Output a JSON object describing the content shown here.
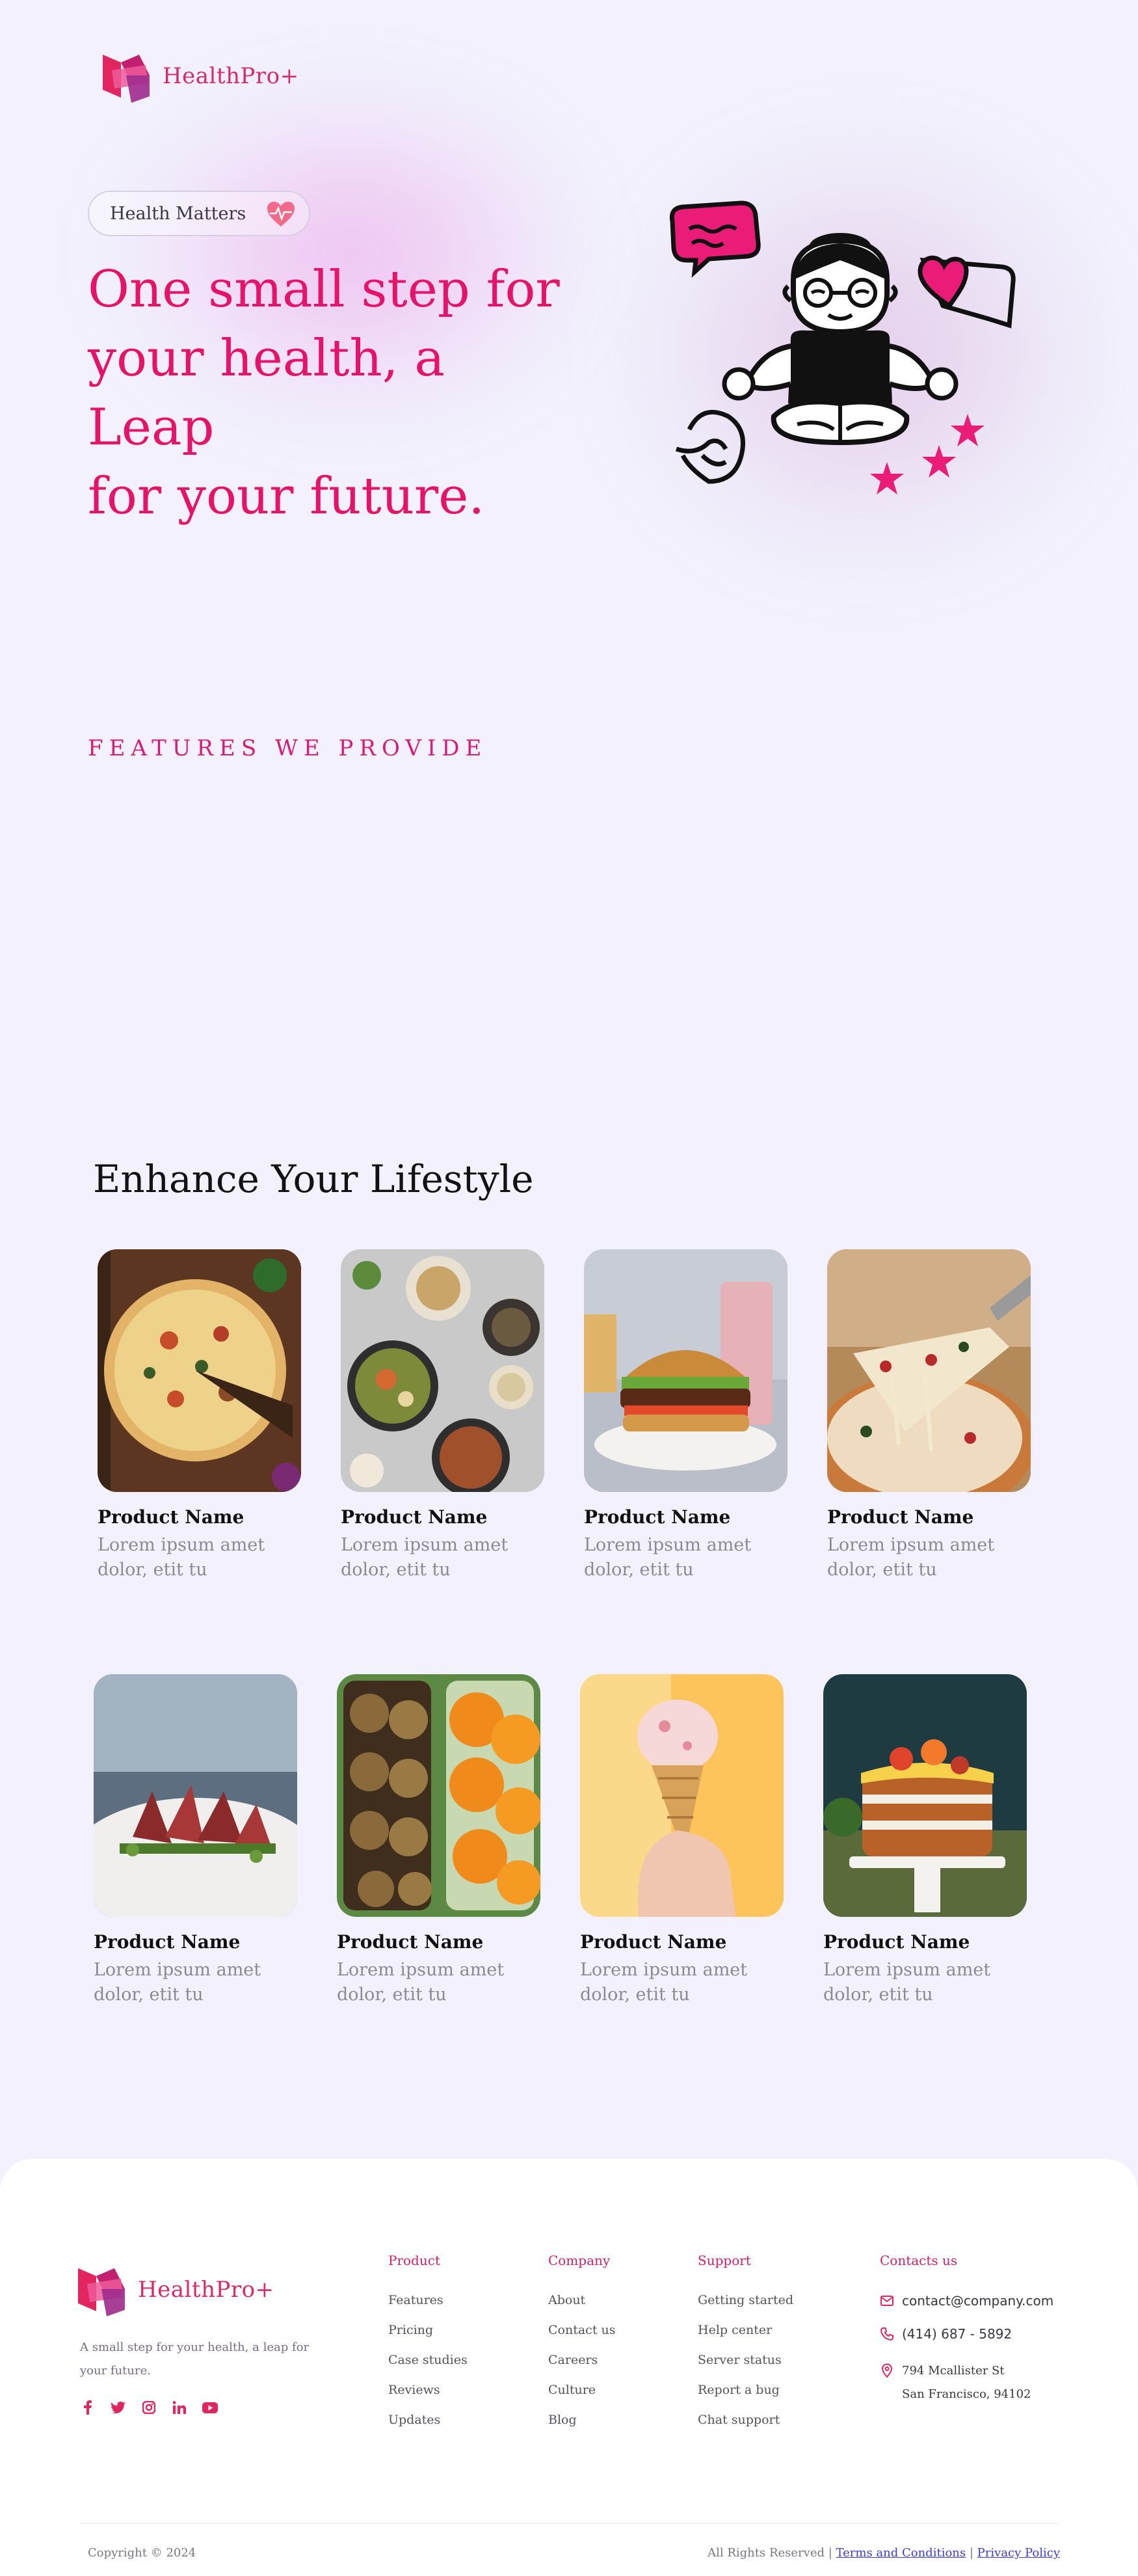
{
  "brand": {
    "name": "HealthPro+"
  },
  "hero": {
    "badge_label": "Health Matters",
    "title_lines": [
      "One small step for",
      "your health, a Leap",
      "for your future."
    ]
  },
  "features": {
    "label": "FEATURES WE PROVIDE"
  },
  "products": {
    "title": "Enhance Your Lifestyle",
    "items": [
      {
        "name": "Product Name",
        "desc": "Lorem ipsum amet dolor, etit tu",
        "image": "pizza"
      },
      {
        "name": "Product Name",
        "desc": "Lorem ipsum amet dolor, etit tu",
        "image": "thai-dishes"
      },
      {
        "name": "Product Name",
        "desc": "Lorem ipsum amet dolor, etit tu",
        "image": "burger"
      },
      {
        "name": "Product Name",
        "desc": "Lorem ipsum amet dolor, etit tu",
        "image": "cheese-pizza-slice"
      },
      {
        "name": "Product Name",
        "desc": "Lorem ipsum amet dolor, etit tu",
        "image": "seared-steak"
      },
      {
        "name": "Product Name",
        "desc": "Lorem ipsum amet dolor, etit tu",
        "image": "oranges-kiwis"
      },
      {
        "name": "Product Name",
        "desc": "Lorem ipsum amet dolor, etit tu",
        "image": "ice-cream-cone"
      },
      {
        "name": "Product Name",
        "desc": "Lorem ipsum amet dolor, etit tu",
        "image": "layer-cake"
      }
    ]
  },
  "footer": {
    "tagline": "A small step for your health, a leap for your future.",
    "socials": [
      "facebook-icon",
      "twitter-icon",
      "instagram-icon",
      "linkedin-icon",
      "youtube-icon"
    ],
    "columns": [
      {
        "title": "Product",
        "links": [
          "Features",
          "Pricing",
          "Case studies",
          "Reviews",
          "Updates"
        ]
      },
      {
        "title": "Company",
        "links": [
          "About",
          "Contact us",
          "Careers",
          "Culture",
          "Blog"
        ]
      },
      {
        "title": "Support",
        "links": [
          "Getting started",
          "Help center",
          "Server status",
          "Report a bug",
          "Chat support"
        ]
      }
    ],
    "contact": {
      "title": "Contacts us",
      "email": "contact@company.com",
      "phone": "(414) 687 - 5892",
      "address_line1": "794 Mcallister St",
      "address_line2": "San Francisco, 94102"
    },
    "copyright": "Copyright © 2024",
    "rights": "All Rights Reserved |",
    "terms": "Terms and Conditions",
    "separator": "|",
    "privacy": "Privacy Policy"
  },
  "colors": {
    "accent": "#e7136b",
    "background": "#f2f1fd",
    "footer_bg": "#ffffff",
    "muted_text": "#8d8a8f"
  }
}
